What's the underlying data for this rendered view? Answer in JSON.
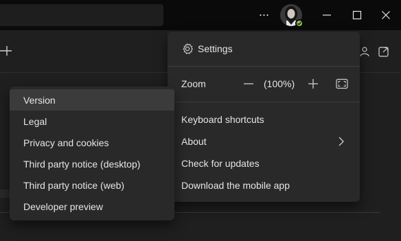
{
  "titlebar": {
    "more_label": "···",
    "presence_color": "#92c353",
    "icons": [
      "more-icon",
      "avatar",
      "minimize-icon",
      "maximize-icon",
      "close-icon"
    ]
  },
  "settings_menu": {
    "settings_label": "Settings",
    "zoom_label": "Zoom",
    "zoom_value": "(100%)",
    "items": [
      {
        "label": "Keyboard shortcuts"
      },
      {
        "label": "About"
      },
      {
        "label": "Check for updates"
      },
      {
        "label": "Download the mobile app"
      }
    ]
  },
  "about_submenu": {
    "items": [
      {
        "label": "Version"
      },
      {
        "label": "Legal"
      },
      {
        "label": "Privacy and cookies"
      },
      {
        "label": "Third party notice (desktop)"
      },
      {
        "label": "Third party notice (web)"
      },
      {
        "label": "Developer preview"
      }
    ]
  }
}
